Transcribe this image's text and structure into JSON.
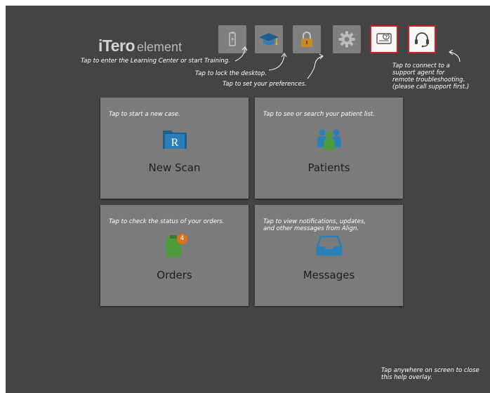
{
  "app": {
    "logo_brand": "iTero",
    "logo_word": "element"
  },
  "toolbar": {
    "buttons": [
      {
        "name": "battery-button",
        "icon": "battery-icon",
        "highlighted": false
      },
      {
        "name": "learning-center-button",
        "icon": "graduation-cap-icon",
        "highlighted": false
      },
      {
        "name": "lock-button",
        "icon": "lock-icon",
        "highlighted": false
      },
      {
        "name": "settings-button",
        "icon": "gear-icon",
        "highlighted": false
      },
      {
        "name": "remote-support-button",
        "icon": "help-screen-icon",
        "highlighted": true
      },
      {
        "name": "headset-button",
        "icon": "headset-icon",
        "highlighted": true
      }
    ]
  },
  "help_notes": {
    "learning_center": "Tap to enter the Learning Center or start Training.",
    "lock": "Tap to lock the desktop.",
    "preferences": "Tap to set your preferences.",
    "support": "Tap to connect to a\nsupport agent for\nremote troubleshooting.\n(please call support first.)",
    "close_overlay": "Tap anywhere on screen to close\nthis help overlay."
  },
  "tiles": {
    "new_scan": {
      "label": "New Scan",
      "note": "Tap to start a new case.",
      "icon": "folder-rx-icon"
    },
    "patients": {
      "label": "Patients",
      "note": "Tap to see or search your patient list.",
      "icon": "patients-icon"
    },
    "orders": {
      "label": "Orders",
      "note": "Tap to check the status of your orders.",
      "icon": "orders-clipboard-icon",
      "badge_count": "4"
    },
    "messages": {
      "label": "Messages",
      "note": "Tap to view notifications, updates,\nand other messages from Align.",
      "icon": "inbox-tray-icon"
    }
  },
  "colors": {
    "overlay_bg": "#444444",
    "tile_bg": "#7b7b7b",
    "highlight_border": "#d01f26",
    "badge": "#e0701a",
    "icon_blue": "#2a7fb8",
    "icon_green": "#4e9a3a"
  }
}
